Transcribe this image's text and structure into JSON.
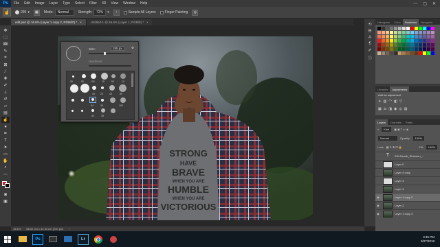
{
  "app": {
    "logo": "Ps",
    "menu": [
      "File",
      "Edit",
      "Image",
      "Layer",
      "Type",
      "Select",
      "Filter",
      "3D",
      "View",
      "Window",
      "Help"
    ],
    "window_controls": [
      "—",
      "▢",
      "✕"
    ]
  },
  "options": {
    "brush_size": "295",
    "mode_label": "Mode:",
    "mode_value": "Normal",
    "strength_label": "Strength:",
    "strength_value": "72%",
    "sample_all_layers": "Sample All Layers",
    "finger_painting": "Finger Painting"
  },
  "tabs": [
    {
      "label": "edit.psd @ 16.6% (Layer 1 copy 2, RGB/8*) *",
      "active": true
    },
    {
      "label": "Untitled-1 @ 66.8% (Layer 1, RGB/8) *",
      "active": false
    }
  ],
  "brush_panel": {
    "size_label": "Size:",
    "size_value": "295 px",
    "hardness_label": "Hardness:",
    "brush_sizes": [
      "30",
      "50",
      "100",
      "25",
      "50",
      "10",
      "90",
      "100",
      "15",
      "20",
      "40",
      "80",
      "34",
      "36",
      "100",
      "40",
      "35"
    ]
  },
  "panels": {
    "top_tabs": [
      "Histogram",
      "Color",
      "Swatches",
      "Navigator"
    ],
    "active_top_tab": "Swatches",
    "adj_tabs": [
      "Libraries",
      "Adjustments"
    ],
    "active_adj_tab": "Adjustments",
    "add_adjustment": "Add an adjustment",
    "layer_tabs": [
      "Layers",
      "Channels",
      "Paths"
    ],
    "active_layer_tab": "Layers",
    "kind_label": "Kind",
    "blend_mode": "Normal",
    "opacity_label": "Opacity:",
    "opacity_value": "100%",
    "lock_label": "Lock:",
    "fill_label": "Fill:",
    "fill_value": "100%",
    "layers": [
      {
        "name": "EDI-Nezak_Shaheen_...",
        "type": "text",
        "visible": false,
        "selected": false
      },
      {
        "name": "Layer 5",
        "type": "img",
        "visible": false,
        "selected": false
      },
      {
        "name": "Layer 4 copy",
        "type": "img",
        "visible": false,
        "selected": false
      },
      {
        "name": "Layer 4",
        "type": "img",
        "visible": false,
        "selected": false
      },
      {
        "name": "Layer 3",
        "type": "img",
        "visible": false,
        "selected": false
      },
      {
        "name": "Layer 1 copy 2",
        "type": "img",
        "visible": true,
        "selected": true
      },
      {
        "name": "Layer 2",
        "type": "img",
        "visible": true,
        "selected": false
      },
      {
        "name": "Layer 1 copy 3",
        "type": "img",
        "visible": true,
        "selected": false
      }
    ]
  },
  "status": {
    "zoom": "16.6%",
    "doc_info": "88.02 cm x 42.33 cm (240 ppi)"
  },
  "photo": {
    "shirt_lines": [
      "STRONG",
      "HAVE",
      "BRAVE",
      "WHEN YOU ARE",
      "HUMBLE",
      "WHEN YOU ARE",
      "VICTORIOUS"
    ]
  },
  "taskbar": {
    "time": "3:45 PM",
    "date": "3/27/2018"
  },
  "colors": {
    "accent": "#31a8ff",
    "foreground_color": "#e51a1a",
    "background_color": "#000000"
  }
}
